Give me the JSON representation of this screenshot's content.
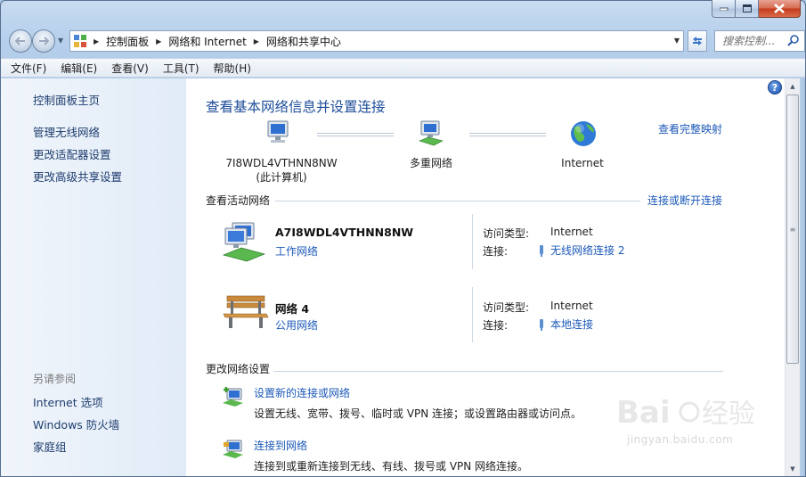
{
  "breadcrumb": [
    "控制面板",
    "网络和 Internet",
    "网络和共享中心"
  ],
  "search": {
    "placeholder": "搜索控制..."
  },
  "menu": [
    "文件(F)",
    "编辑(E)",
    "查看(V)",
    "工具(T)",
    "帮助(H)"
  ],
  "sidebar": {
    "home": "控制面板主页",
    "links": [
      "管理无线网络",
      "更改适配器设置",
      "更改高级共享设置"
    ],
    "see_also_title": "另请参阅",
    "see_also": [
      "Internet 选项",
      "Windows 防火墙",
      "家庭组"
    ]
  },
  "main": {
    "title": "查看基本网络信息并设置连接",
    "map_link": "查看完整映射",
    "map": {
      "computer_name": "7I8WDL4VTHNN8NW",
      "computer_note": "(此计算机)",
      "middle": "多重网络",
      "internet": "Internet"
    },
    "active_title": "查看活动网络",
    "active_link": "连接或断开连接",
    "networks": [
      {
        "name": "A7I8WDL4VTHNN8NW",
        "type": "工作网络",
        "access_label": "访问类型:",
        "access": "Internet",
        "conn_label": "连接:",
        "conn": "无线网络连接 2"
      },
      {
        "name": "网络  4",
        "type": "公用网络",
        "access_label": "访问类型:",
        "access": "Internet",
        "conn_label": "连接:",
        "conn": "本地连接"
      }
    ],
    "change_title": "更改网络设置",
    "tasks": [
      {
        "link": "设置新的连接或网络",
        "desc": "设置无线、宽带、拨号、临时或 VPN 连接；或设置路由器或访问点。"
      },
      {
        "link": "连接到网络",
        "desc": "连接到或重新连接到无线、有线、拨号或 VPN 网络连接。"
      }
    ]
  },
  "watermark": {
    "text": "jingyan.baidu.com"
  }
}
